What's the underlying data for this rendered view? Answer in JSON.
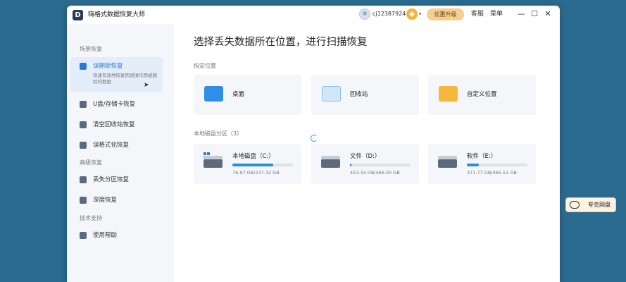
{
  "app": {
    "logo_letter": "D",
    "title": "嗨格式数据恢复大师"
  },
  "header": {
    "username": "cj12387924",
    "vip_caret": "▾",
    "upgrade_label": "优惠升级",
    "service_label": "客服",
    "menu_label": "菜单",
    "minimize": "—",
    "maximize": "☐",
    "close": "✕"
  },
  "sidebar": {
    "section_scene": "场景恢复",
    "active_item": {
      "label": "误删除恢复",
      "desc": "快速有效地恢复因误操作而被删除的数据",
      "icon": "document-icon"
    },
    "items": [
      {
        "label": "U盘/存储卡恢复",
        "icon": "usb-icon"
      },
      {
        "label": "清空回收站恢复",
        "icon": "trash-icon"
      },
      {
        "label": "误格式化恢复",
        "icon": "format-icon"
      }
    ],
    "section_advanced": "高级恢复",
    "advanced_items": [
      {
        "label": "丢失分区恢复",
        "icon": "partition-icon"
      },
      {
        "label": "深度恢复",
        "icon": "deep-scan-icon"
      }
    ],
    "section_support": "技术支持",
    "support_items": [
      {
        "label": "使用帮助",
        "icon": "help-icon"
      }
    ]
  },
  "main": {
    "title": "选择丢失数据所在位置，进行扫描恢复",
    "locations_head": "指定位置",
    "locations": [
      {
        "label": "桌面",
        "icon": "desktop-icon"
      },
      {
        "label": "回收站",
        "icon": "recycle-bin-icon"
      },
      {
        "label": "自定义位置",
        "icon": "folder-icon"
      }
    ],
    "disks_head": "本地磁盘分区（3）",
    "disks": [
      {
        "name": "本地磁盘（C:）",
        "size": "76.97 GB/237.32 GB",
        "used_fraction": 0.676
      },
      {
        "name": "文件（D:）",
        "size": "453.34 GB/466.00 GB",
        "used_fraction": 0.027
      },
      {
        "name": "软件（E:）",
        "size": "371.77 GB/465.51 GB",
        "used_fraction": 0.201
      }
    ]
  },
  "float_widget": {
    "label": "夸克网盘"
  },
  "colors": {
    "accent": "#2a7ad5",
    "upgrade_bg": "#f5cf8f",
    "desktop_bg": "#2b6b8f"
  }
}
